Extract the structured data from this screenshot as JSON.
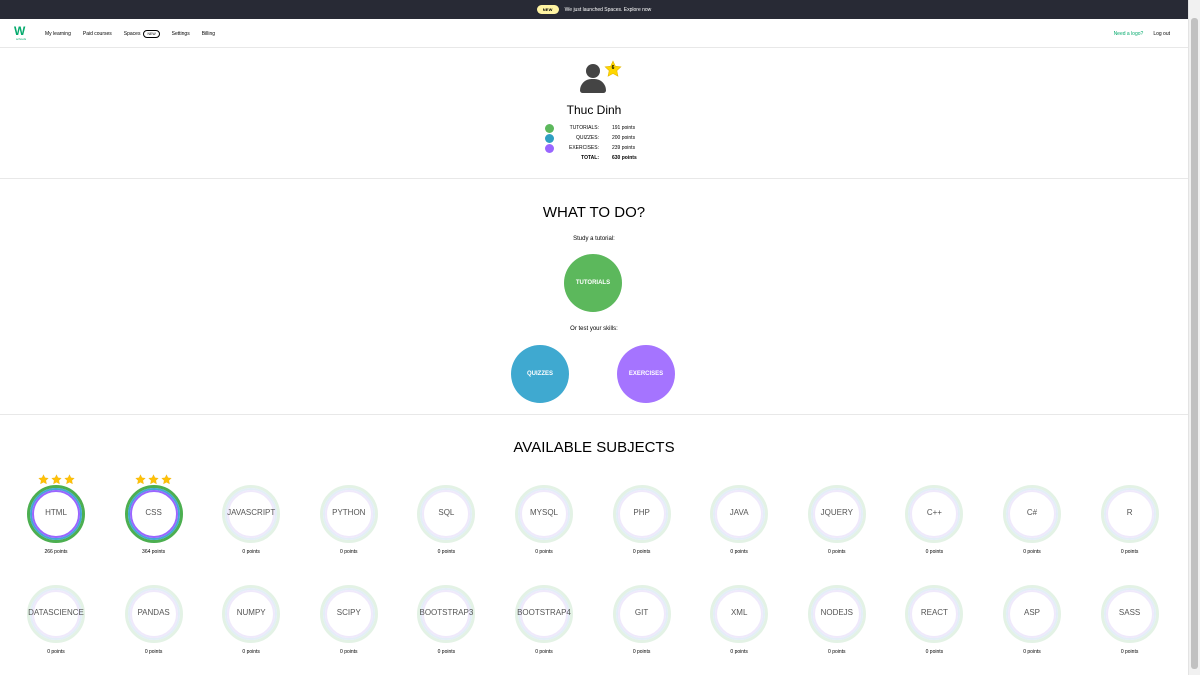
{
  "announcement": {
    "badge": "NEW",
    "text": "We just launched Spaces.",
    "link": "Explore now"
  },
  "nav": {
    "logo_text": "W",
    "logo_sub": "schools",
    "links": [
      "My learning",
      "Paid courses",
      "Spaces",
      "Settings",
      "Billing"
    ],
    "spaces_badge": "NEW",
    "need_logo": "Need a logo?",
    "logout": "Log out"
  },
  "profile": {
    "name": "Thuc Dinh",
    "level": "6",
    "stats": [
      {
        "label": "TUTORIALS:",
        "value": "191 points",
        "color": "#5cb85c"
      },
      {
        "label": "QUIZZES:",
        "value": "200 points",
        "color": "#2f9fc2"
      },
      {
        "label": "EXERCISES:",
        "value": "239 points",
        "color": "#9966ff"
      }
    ],
    "total_label": "TOTAL:",
    "total_value": "630 points"
  },
  "what_to_do": {
    "title": "WHAT TO DO?",
    "study_text": "Study a tutorial:",
    "test_text": "Or test your skills:",
    "tutorials": "TUTORIALS",
    "quizzes": "QUIZZES",
    "exercises": "EXERCISES",
    "colors": {
      "tutorials": "#5cb85c",
      "quizzes": "#3fa9d0",
      "exercises": "#a574ff"
    }
  },
  "subjects": {
    "title": "AVAILABLE SUBJECTS",
    "items": [
      {
        "name": "HTML",
        "points": "266 points",
        "stars": 3
      },
      {
        "name": "CSS",
        "points": "364 points",
        "stars": 3
      },
      {
        "name": "JAVASCRIPT",
        "points": "0 points",
        "stars": 0
      },
      {
        "name": "PYTHON",
        "points": "0 points",
        "stars": 0
      },
      {
        "name": "SQL",
        "points": "0 points",
        "stars": 0
      },
      {
        "name": "MYSQL",
        "points": "0 points",
        "stars": 0
      },
      {
        "name": "PHP",
        "points": "0 points",
        "stars": 0
      },
      {
        "name": "JAVA",
        "points": "0 points",
        "stars": 0
      },
      {
        "name": "JQUERY",
        "points": "0 points",
        "stars": 0
      },
      {
        "name": "C++",
        "points": "0 points",
        "stars": 0
      },
      {
        "name": "C#",
        "points": "0 points",
        "stars": 0
      },
      {
        "name": "R",
        "points": "0 points",
        "stars": 0
      },
      {
        "name": "DATASCIENCE",
        "points": "0 points",
        "stars": 0
      },
      {
        "name": "PANDAS",
        "points": "0 points",
        "stars": 0
      },
      {
        "name": "NUMPY",
        "points": "0 points",
        "stars": 0
      },
      {
        "name": "SCIPY",
        "points": "0 points",
        "stars": 0
      },
      {
        "name": "BOOTSTRAP3",
        "points": "0 points",
        "stars": 0
      },
      {
        "name": "BOOTSTRAP4",
        "points": "0 points",
        "stars": 0
      },
      {
        "name": "GIT",
        "points": "0 points",
        "stars": 0
      },
      {
        "name": "XML",
        "points": "0 points",
        "stars": 0
      },
      {
        "name": "NODEJS",
        "points": "0 points",
        "stars": 0
      },
      {
        "name": "REACT",
        "points": "0 points",
        "stars": 0
      },
      {
        "name": "ASP",
        "points": "0 points",
        "stars": 0
      },
      {
        "name": "SASS",
        "points": "0 points",
        "stars": 0
      }
    ]
  }
}
